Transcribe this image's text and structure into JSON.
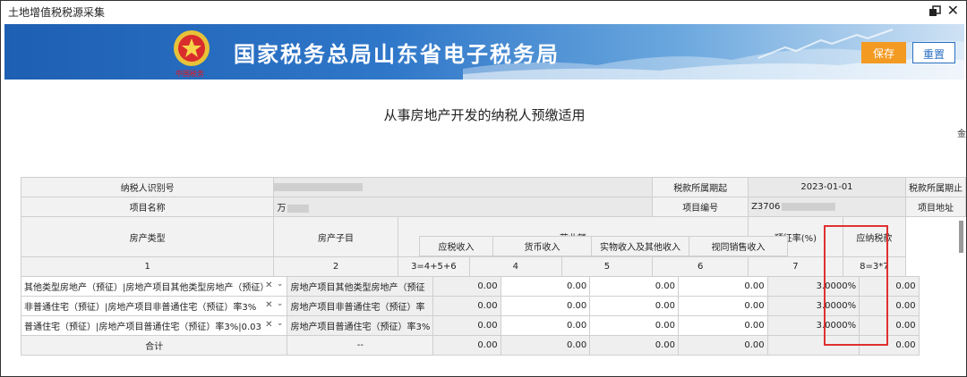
{
  "window": {
    "title": "土地增值税税源采集"
  },
  "banner": {
    "title": "国家税务总局山东省电子税务局",
    "emblem_caption": "中国税务"
  },
  "toolbar": {
    "save_label": "保存",
    "reset_label": "重置"
  },
  "heading": "从事房地产开发的纳税人预缴适用",
  "info_rows": {
    "taxpayer_id_label": "纳税人识别号",
    "period_start_label": "税款所属期起",
    "period_start_value": "2023-01-01",
    "period_end_label": "税款所属期止",
    "project_name_label": "项目名称",
    "project_name_value": "万",
    "project_no_label": "项目编号",
    "project_no_value": "Z3706",
    "project_addr_label": "项目地址"
  },
  "headers": {
    "type": "房产类型",
    "subtype": "房产子目",
    "revenue_group": "营业额",
    "receivable": "应税收入",
    "cash": "货币收入",
    "inkind": "实物收入及其他收入",
    "deemed": "视同销售收入",
    "rate": "预征率(%)",
    "tax": "应纳税款"
  },
  "index_row": [
    "1",
    "2",
    "3=4+5+6",
    "4",
    "5",
    "6",
    "7",
    "8=3*7"
  ],
  "rows": [
    {
      "type": "其他类型房地产（预征）|房地产项目其他类型房地产（预征）",
      "subtype": "房地产项目其他类型房地产（预征",
      "receivable": "0.00",
      "cash": "0.00",
      "inkind": "0.00",
      "deemed": "0.00",
      "rate": "3.0000%",
      "tax": "0.00"
    },
    {
      "type": "非普通住宅（预征）|房地产项目非普通住宅（预征）率3%",
      "subtype": "房地产项目非普通住宅（预征）率",
      "receivable": "0.00",
      "cash": "0.00",
      "inkind": "0.00",
      "deemed": "0.00",
      "rate": "3.0000%",
      "tax": "0.00"
    },
    {
      "type": "普通住宅（预征）|房地产项目普通住宅（预征）率3%|0.03",
      "subtype": "房地产项目普通住宅（预征）率3%",
      "receivable": "0.00",
      "cash": "0.00",
      "inkind": "0.00",
      "deemed": "0.00",
      "rate": "3.0000%",
      "tax": "0.00"
    }
  ],
  "total_row": {
    "label": "合计",
    "subtype": "--",
    "receivable": "0.00",
    "cash": "0.00",
    "inkind": "0.00",
    "deemed": "0.00",
    "rate": "",
    "tax": "0.00"
  },
  "side_glyph": "金",
  "colors": {
    "banner_blue": "#1d5fb3",
    "save_orange": "#f39a22",
    "highlight_red": "#e03030"
  }
}
